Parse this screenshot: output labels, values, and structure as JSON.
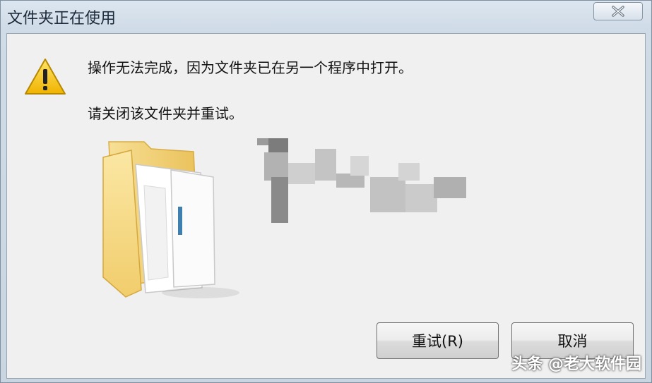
{
  "window": {
    "title": "文件夹正在使用"
  },
  "message": {
    "line1": "操作无法完成，因为文件夹已在另一个程序中打开。",
    "line2": "请关闭该文件夹并重试。"
  },
  "icons": {
    "warning": "warning-icon",
    "folder": "folder-icon",
    "close": "close-icon"
  },
  "buttons": {
    "retry_label": "重试(R)",
    "cancel_label": "取消"
  },
  "watermark": {
    "text": "头条 @老大软件园"
  },
  "colors": {
    "warning_yellow": "#f5c518",
    "folder_yellow": "#f2d27a",
    "close_x": "#6b7886"
  }
}
